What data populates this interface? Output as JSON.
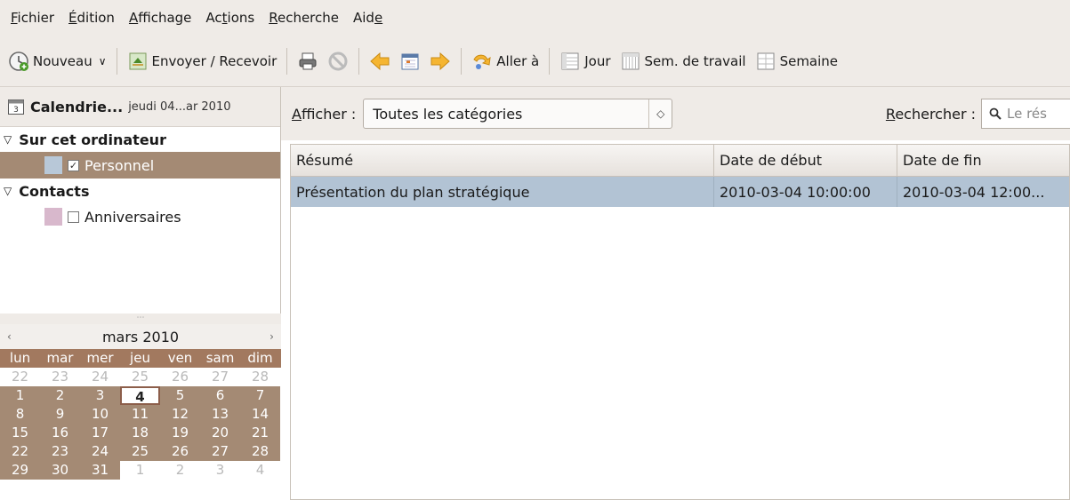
{
  "menubar": {
    "items": [
      {
        "pre": "",
        "ul": "F",
        "post": "ichier"
      },
      {
        "pre": "",
        "ul": "É",
        "post": "dition"
      },
      {
        "pre": "",
        "ul": "A",
        "post": "ffichage"
      },
      {
        "pre": "Ac",
        "ul": "t",
        "post": "ions"
      },
      {
        "pre": "",
        "ul": "R",
        "post": "echerche"
      },
      {
        "pre": "Aid",
        "ul": "e",
        "post": ""
      }
    ]
  },
  "toolbar": {
    "new_label": "Nouveau",
    "sendrecv_label": "Envoyer / Recevoir",
    "goto_label": "Aller à",
    "day_label": "Jour",
    "workweek_label": "Sem. de travail",
    "week_label": "Semaine"
  },
  "sidebar": {
    "title": "Calendrie...",
    "date": "jeudi 04...ar 2010",
    "groups": [
      {
        "label": "Sur cet ordinateur",
        "items": [
          {
            "label": "Personnel",
            "checked": true,
            "color": "#b8c8d8"
          }
        ]
      },
      {
        "label": "Contacts",
        "items": [
          {
            "label": "Anniversaires",
            "checked": false,
            "color": "#d8b8cc"
          }
        ]
      }
    ]
  },
  "minimonth": {
    "title": "mars 2010",
    "days": [
      "lun",
      "mar",
      "mer",
      "jeu",
      "ven",
      "sam",
      "dim"
    ],
    "weeks": [
      [
        "22",
        "23",
        "24",
        "25",
        "26",
        "27",
        "28"
      ],
      [
        "1",
        "2",
        "3",
        "4",
        "5",
        "6",
        "7"
      ],
      [
        "8",
        "9",
        "10",
        "11",
        "12",
        "13",
        "14"
      ],
      [
        "15",
        "16",
        "17",
        "18",
        "19",
        "20",
        "21"
      ],
      [
        "22",
        "23",
        "24",
        "25",
        "26",
        "27",
        "28"
      ],
      [
        "29",
        "30",
        "31",
        "1",
        "2",
        "3",
        "4"
      ]
    ]
  },
  "filter": {
    "show_label_ul": "A",
    "show_label_rest": "fficher :",
    "category": "Toutes les catégories",
    "search_label_ul": "R",
    "search_label_rest": "echercher :",
    "search_placeholder": "Le rés"
  },
  "list": {
    "columns": [
      "Résumé",
      "Date de début",
      "Date de fin"
    ],
    "rows": [
      [
        "Présentation du plan stratégique",
        "2010-03-04 10:00:00",
        "2010-03-04 12:00..."
      ]
    ]
  }
}
